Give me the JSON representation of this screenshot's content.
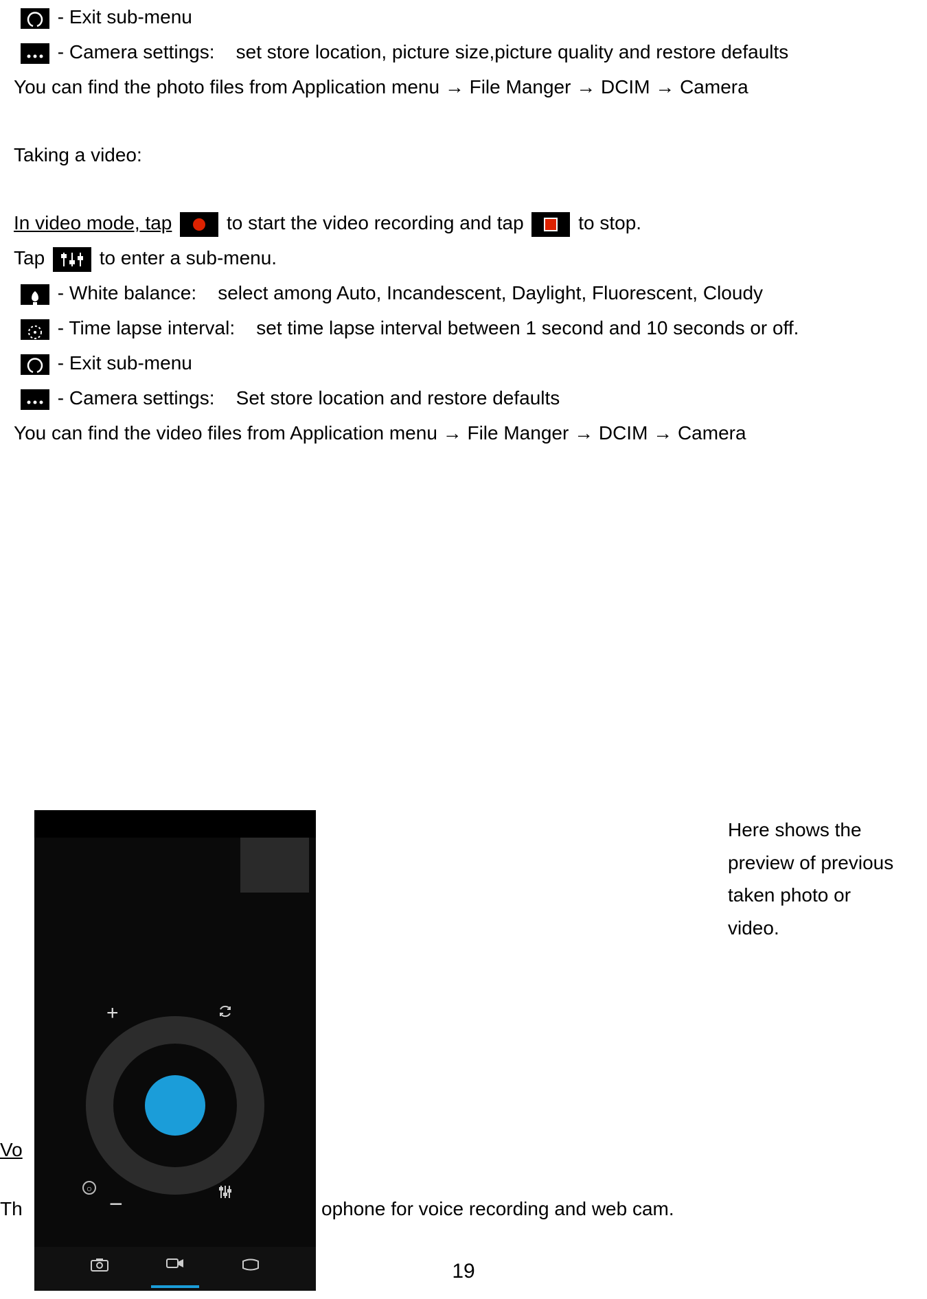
{
  "photo_section": {
    "exit_label": "- Exit sub-menu",
    "settings_label": "- Camera settings:",
    "settings_desc": "set store location, picture size,picture quality and restore defaults",
    "find_photo": "You can find the photo files from Application menu → File Manger → DCIM → Camera"
  },
  "video_section": {
    "heading": "Taking a video:",
    "intro_pre": "In video mode, tap",
    "intro_mid": "to start the video recording and tap",
    "intro_post": "to stop.",
    "tap_pre": "Tap",
    "tap_post": "to enter a sub-menu.",
    "wb_label": "- White balance:",
    "wb_desc": "select among Auto, Incandescent, Daylight, Fluorescent, Cloudy",
    "tl_label": "- Time lapse interval:",
    "tl_desc": "set time lapse interval between 1 second and 10 seconds or off.",
    "exit_label": "- Exit sub-menu",
    "settings_label": "- Camera settings:",
    "settings_desc": "Set store location and restore defaults",
    "find_video": "You can find the video files from Application menu → File Manger → DCIM → Camera"
  },
  "callout_text": "Here shows the preview of previous taken photo or video.",
  "vo_prefix": "Vo",
  "th_prefix": "Th",
  "th_suffix": "ophone for voice recording and web cam.",
  "page_number": "19",
  "screenshot_modes": {
    "camera": "📷",
    "video": "■",
    "pan": "⫽"
  }
}
